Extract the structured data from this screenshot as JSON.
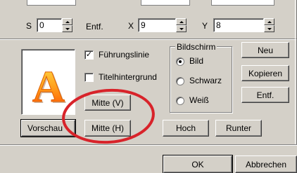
{
  "top_row": {
    "s_label": "S",
    "s_value": "0",
    "entf_label": "Entf.",
    "x_label": "X",
    "x_value": "9",
    "y_label": "Y",
    "y_value": "8"
  },
  "preview": {
    "letter": "A",
    "button": "Vorschau"
  },
  "options": {
    "fuehrungslinie": {
      "label": "Führungslinie",
      "checked": true
    },
    "titelhintergrund": {
      "label": "Titelhintergrund",
      "checked": false
    }
  },
  "bildschirm": {
    "title": "Bildschirm",
    "options": [
      {
        "label": "Bild",
        "selected": true
      },
      {
        "label": "Schwarz",
        "selected": false
      },
      {
        "label": "Weiß",
        "selected": false
      }
    ]
  },
  "buttons": {
    "neu": "Neu",
    "kopieren": "Kopieren",
    "entf": "Entf.",
    "mitte_v": "Mitte (V)",
    "mitte_h": "Mitte (H)",
    "hoch": "Hoch",
    "runter": "Runter",
    "ok": "OK",
    "abbrechen": "Abbrechen"
  },
  "colors": {
    "annotation_circle": "#d8232a",
    "letter_orange": "#ff8c00"
  }
}
